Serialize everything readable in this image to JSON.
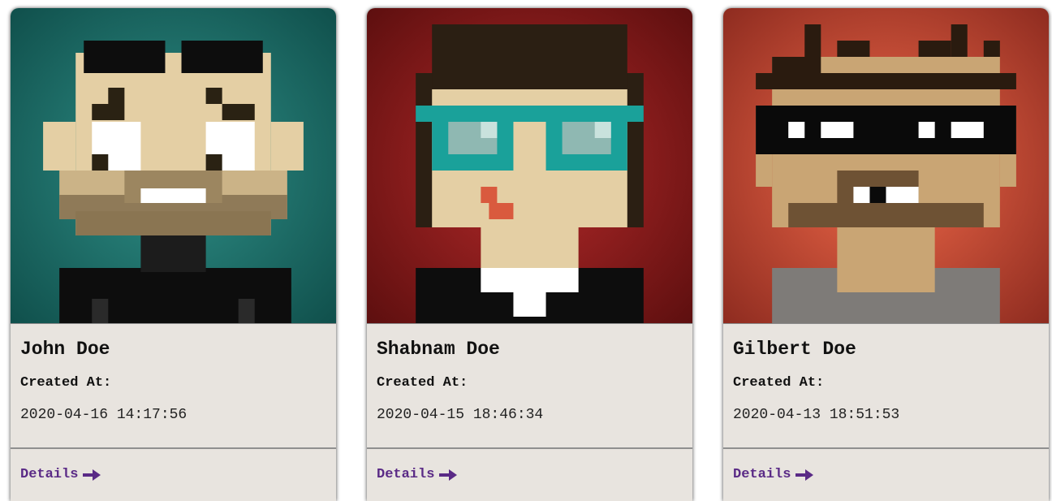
{
  "cards": [
    {
      "name": "John Doe",
      "created_label": "Created At:",
      "created_value": "2020-04-16 14:17:56",
      "details_label": "Details",
      "avatar_icon": "pixel-avatar-bald-beard-icon",
      "background_color": "#1f6f6b"
    },
    {
      "name": "Shabnam Doe",
      "created_label": "Created At:",
      "created_value": "2020-04-15 18:46:34",
      "details_label": "Details",
      "avatar_icon": "pixel-avatar-glasses-icon",
      "background_color": "#9a1e1e"
    },
    {
      "name": "Gilbert Doe",
      "created_label": "Created At:",
      "created_value": "2020-04-13 18:51:53",
      "details_label": "Details",
      "avatar_icon": "pixel-avatar-mask-icon",
      "background_color": "#e25a3f"
    }
  ],
  "colors": {
    "link": "#5a2a86",
    "card_body": "#e8e4df"
  }
}
